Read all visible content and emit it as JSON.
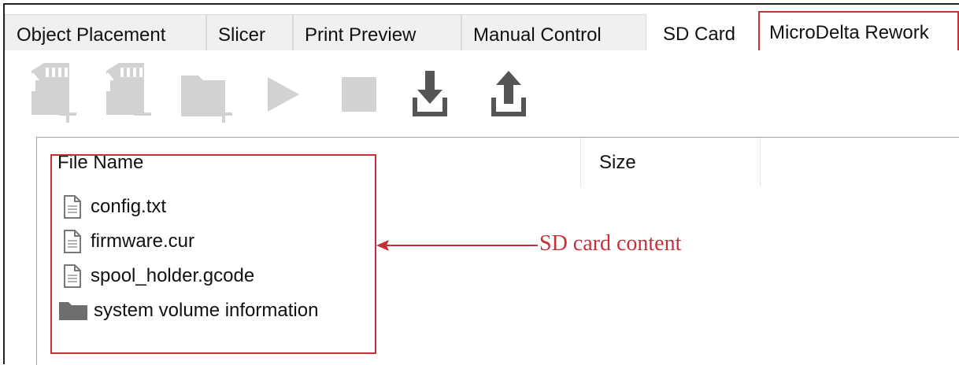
{
  "tabs": [
    {
      "label": "Object Placement",
      "active": false
    },
    {
      "label": "Slicer",
      "active": false
    },
    {
      "label": "Print Preview",
      "active": false
    },
    {
      "label": "Manual Control",
      "active": false
    },
    {
      "label": "SD Card",
      "active": true
    },
    {
      "label": "MicroDelta Rework",
      "active": false
    }
  ],
  "toolbar": {
    "buttons": [
      {
        "icon": "sd-card-add-icon",
        "enabled": false
      },
      {
        "icon": "sd-card-remove-icon",
        "enabled": false
      },
      {
        "icon": "new-folder-icon",
        "enabled": false
      },
      {
        "icon": "play-icon",
        "enabled": false
      },
      {
        "icon": "stop-icon",
        "enabled": false
      },
      {
        "icon": "download-icon",
        "enabled": true
      },
      {
        "icon": "upload-icon",
        "enabled": true
      }
    ]
  },
  "file_list": {
    "columns": [
      "File Name",
      "Size"
    ],
    "rows": [
      {
        "name": "config.txt",
        "type": "file",
        "icon": "file-icon"
      },
      {
        "name": "firmware.cur",
        "type": "file",
        "icon": "file-icon"
      },
      {
        "name": "spool_holder.gcode",
        "type": "file",
        "icon": "file-icon"
      },
      {
        "name": "system volume information",
        "type": "folder",
        "icon": "folder-icon"
      }
    ]
  },
  "annotation": {
    "label": "SD card content",
    "color": "#c43137"
  }
}
